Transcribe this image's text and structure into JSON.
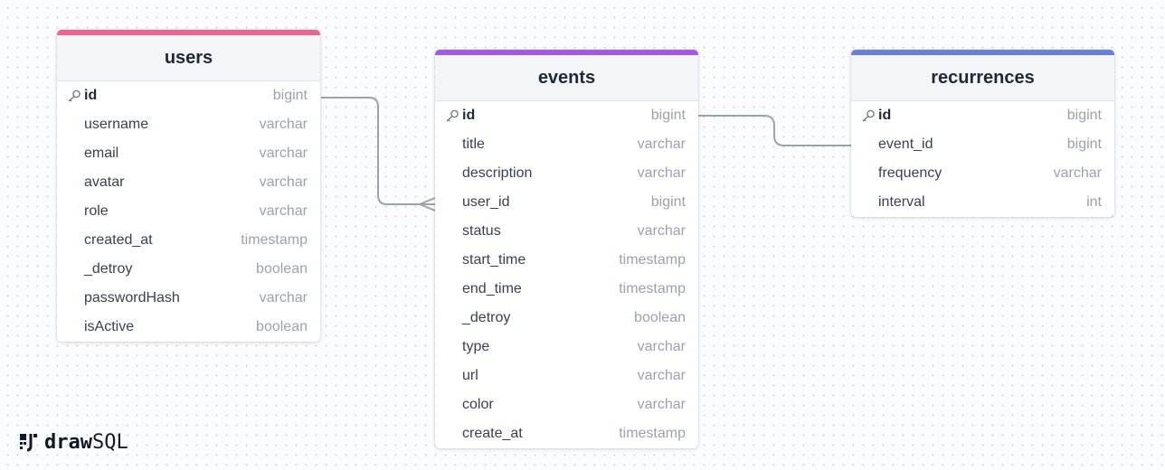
{
  "brand": {
    "draw": "draw",
    "sql": "SQL"
  },
  "colors": {
    "users": "#f06292",
    "events": "#a259e6",
    "recurrences": "#6b7fd7",
    "connector": "#9ca3af"
  },
  "icons": {
    "primary_key": "key-icon",
    "logo": "drawsql-logo-icon"
  },
  "tables": [
    {
      "name": "users",
      "columns": [
        {
          "name": "id",
          "type": "bigint",
          "pk": true
        },
        {
          "name": "username",
          "type": "varchar"
        },
        {
          "name": "email",
          "type": "varchar"
        },
        {
          "name": "avatar",
          "type": "varchar"
        },
        {
          "name": "role",
          "type": "varchar"
        },
        {
          "name": "created_at",
          "type": "timestamp"
        },
        {
          "name": "_detroy",
          "type": "boolean"
        },
        {
          "name": "passwordHash",
          "type": "varchar"
        },
        {
          "name": "isActive",
          "type": "boolean"
        }
      ]
    },
    {
      "name": "events",
      "columns": [
        {
          "name": "id",
          "type": "bigint",
          "pk": true
        },
        {
          "name": "title",
          "type": "varchar"
        },
        {
          "name": "description",
          "type": "varchar"
        },
        {
          "name": "user_id",
          "type": "bigint"
        },
        {
          "name": "status",
          "type": "varchar"
        },
        {
          "name": "start_time",
          "type": "timestamp"
        },
        {
          "name": "end_time",
          "type": "timestamp"
        },
        {
          "name": "_detroy",
          "type": "boolean"
        },
        {
          "name": "type",
          "type": "varchar"
        },
        {
          "name": "url",
          "type": "varchar"
        },
        {
          "name": "color",
          "type": "varchar"
        },
        {
          "name": "create_at",
          "type": "timestamp"
        }
      ]
    },
    {
      "name": "recurrences",
      "columns": [
        {
          "name": "id",
          "type": "bigint",
          "pk": true
        },
        {
          "name": "event_id",
          "type": "bigint"
        },
        {
          "name": "frequency",
          "type": "varchar"
        },
        {
          "name": "interval",
          "type": "int"
        }
      ]
    }
  ],
  "relations": [
    {
      "from": "users.id",
      "to": "events.user_id",
      "cardinality": "one-to-many"
    },
    {
      "from": "events.id",
      "to": "recurrences.event_id",
      "cardinality": "one-to-one"
    }
  ]
}
